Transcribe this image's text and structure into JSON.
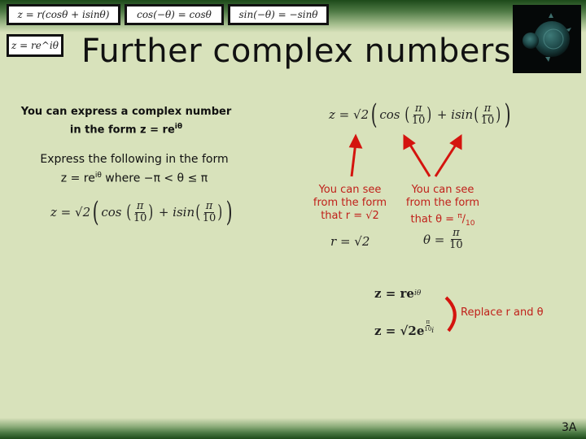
{
  "formula_boxes": [
    "z = r(cosθ + isinθ)",
    "cos(−θ) = cosθ",
    "sin(−θ) = −sinθ",
    "z = re^iθ"
  ],
  "title": "Further complex numbers",
  "intro": {
    "line1": "You can express a complex number",
    "line2_prefix": "in the form z = re",
    "line2_sup": "iθ"
  },
  "task": {
    "line1": "Express the following in the form",
    "line2_prefix": "z = re",
    "line2_sup": "iθ",
    "line2_suffix": " where −π < θ ≤ π"
  },
  "expression": {
    "lhs": "z = √2",
    "cos": "cos",
    "plus": "+ isin",
    "num": "π",
    "den": "10"
  },
  "notes": {
    "r_note": [
      "You can see",
      "from the form",
      "that r = √2"
    ],
    "theta_note_lines": [
      "You can see",
      "from the form"
    ],
    "theta_note_last_prefix": "that θ = ",
    "theta_note_num": "π",
    "theta_note_den": "10"
  },
  "results": {
    "r_value": "r = √2",
    "theta_lhs": "θ =",
    "theta_num": "π",
    "theta_den": "10"
  },
  "substitution": {
    "line1_lhs": "z = re",
    "line1_sup": "iθ",
    "line2_lhs": "z = √2e",
    "line2_sup_num": "π",
    "line2_sup_den": "10",
    "line2_sup_i": "i",
    "label": "Replace r and θ"
  },
  "page_number": "3A",
  "colors": {
    "background": "#d8e2bb",
    "band": "#1d4a1a",
    "annotation": "#c0201a"
  }
}
